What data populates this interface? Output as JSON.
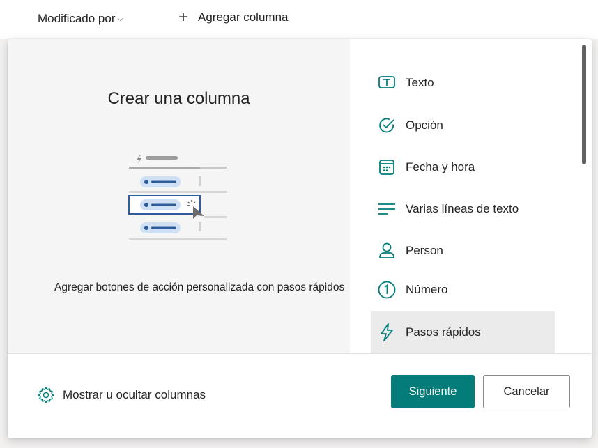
{
  "header": {
    "modified_by_label": "Modificado por",
    "add_column_label": "Agregar columna"
  },
  "dialog": {
    "title": "Crear una columna",
    "description": "Agregar botones de acción personalizada con pasos rápidos",
    "column_types": [
      {
        "label": "Texto",
        "icon": "text-icon"
      },
      {
        "label": "Opción",
        "icon": "choice-check-icon"
      },
      {
        "label": "Fecha y hora",
        "icon": "calendar-icon"
      },
      {
        "label": "Varias líneas de texto",
        "icon": "multiline-text-icon"
      },
      {
        "label": "Person",
        "icon": "person-icon"
      },
      {
        "label": "Número",
        "icon": "number-icon"
      },
      {
        "label": "Pasos rápidos",
        "icon": "lightning-icon",
        "selected": true
      }
    ],
    "footer": {
      "show_hide_label": "Mostrar u ocultar columnas",
      "next_label": "Siguiente",
      "cancel_label": "Cancelar"
    }
  },
  "colors": {
    "accent": "#037c7a",
    "selected_bg": "#ebebeb",
    "pane_bg": "#f5f5f5",
    "illustration_blue": "#2f5c9b",
    "illustration_chip": "#cfe0f5"
  }
}
